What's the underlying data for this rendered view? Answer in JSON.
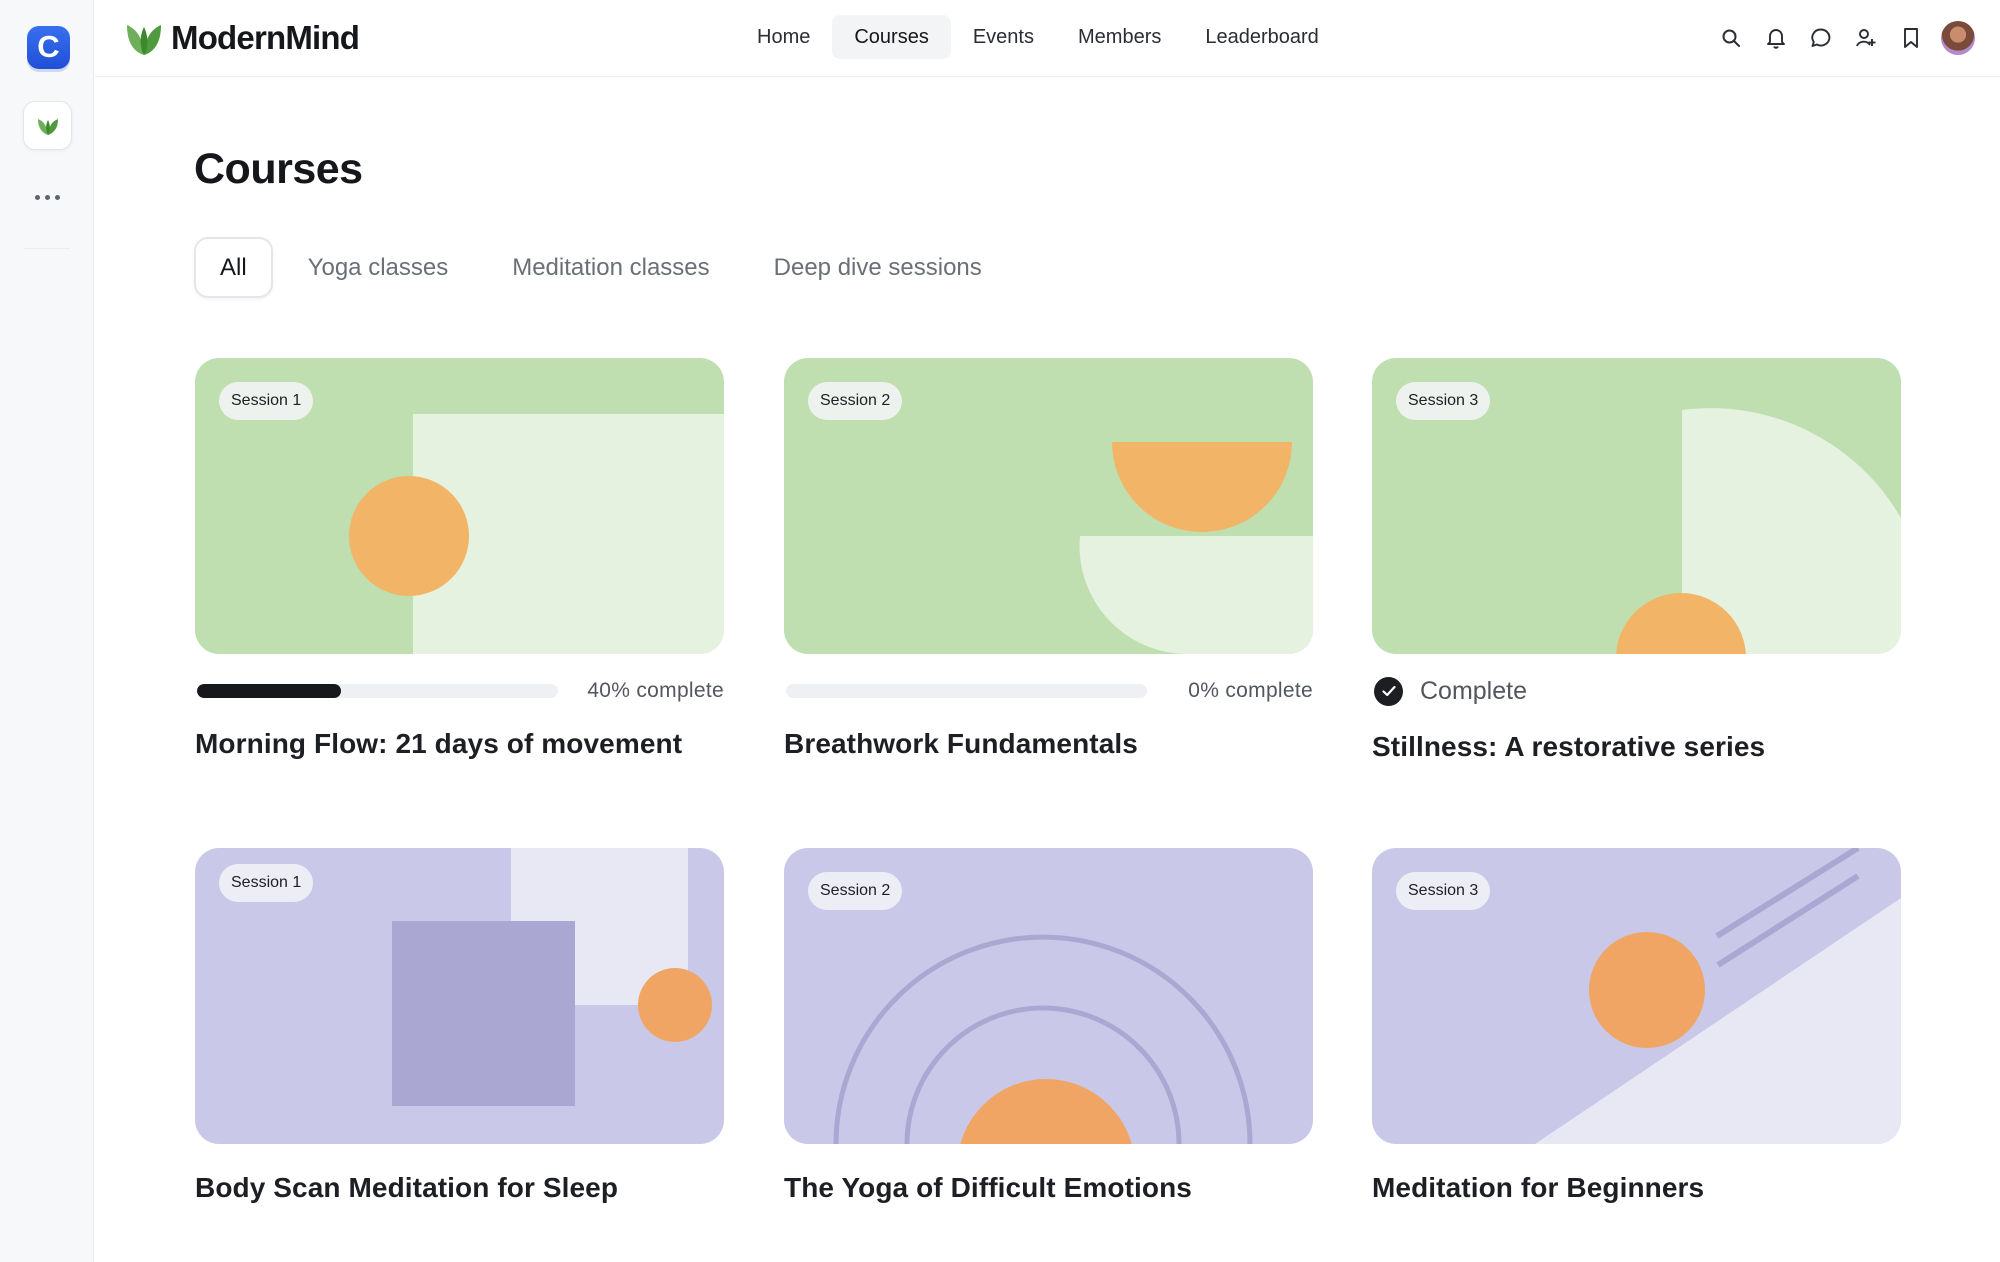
{
  "rail": {
    "app_letter": "C",
    "app_icon": "community-app-icon",
    "space_icon": "leaf-icon",
    "more_icon": "more-horizontal-icon"
  },
  "header": {
    "brand": "ModernMind",
    "brand_icon": "leaf-logo-icon",
    "nav": [
      {
        "label": "Home",
        "active": false
      },
      {
        "label": "Courses",
        "active": true
      },
      {
        "label": "Events",
        "active": false
      },
      {
        "label": "Members",
        "active": false
      },
      {
        "label": "Leaderboard",
        "active": false
      }
    ],
    "tools": [
      "search-icon",
      "bell-icon",
      "chat-icon",
      "add-member-icon",
      "bookmark-icon",
      "user-avatar"
    ]
  },
  "page": {
    "title": "Courses",
    "tabs": [
      {
        "label": "All",
        "active": true
      },
      {
        "label": "Yoga classes",
        "active": false
      },
      {
        "label": "Meditation classes",
        "active": false
      },
      {
        "label": "Deep dive sessions",
        "active": false
      }
    ]
  },
  "courses": [
    {
      "session": "Session 1",
      "title": "Morning Flow: 21 days of movement",
      "progress": 40,
      "progress_label": "40% complete",
      "completed": false
    },
    {
      "session": "Session 2",
      "title": "Breathwork Fundamentals",
      "progress": 0,
      "progress_label": "0% complete",
      "completed": false
    },
    {
      "session": "Session 3",
      "title": "Stillness: A restorative series",
      "completed": true,
      "status_label": "Complete"
    },
    {
      "session": "Session 1",
      "title": "Body Scan Meditation for Sleep"
    },
    {
      "session": "Session 2",
      "title": "The Yoga of Difficult Emotions"
    },
    {
      "session": "Session 3",
      "title": "Meditation for Beginners"
    }
  ],
  "colors": {
    "green_bg": "#bfdfb0",
    "green_light": "#e6f2e0",
    "lavender_bg": "#c9c8e8",
    "lavender_light": "#e8e7f4",
    "lavender_dark": "#aaa8d2",
    "orange": "#f2b466",
    "orange_2": "#f0a564"
  }
}
